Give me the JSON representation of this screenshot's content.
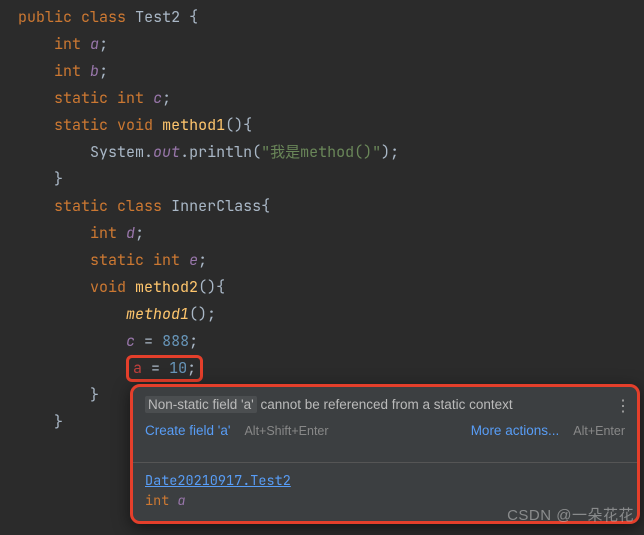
{
  "code": {
    "kw_public": "public",
    "kw_class": "class",
    "kw_int": "int",
    "kw_static": "static",
    "kw_void": "void",
    "cls_Test2": "Test2",
    "cls_InnerClass": "InnerClass",
    "field_a": "a",
    "field_b": "b",
    "field_c": "c",
    "field_d": "d",
    "field_e": "e",
    "method1": "method1",
    "method2": "method2",
    "sys": "System",
    "out": "out",
    "println": "println",
    "str_method": "\"我是method()\"",
    "num_888": "888",
    "num_10": "10",
    "err_a": "a"
  },
  "tooltip": {
    "hl_text": "Non-static field 'a'",
    "msg_rest": " cannot be referenced from a static context",
    "create_field": "Create field 'a'",
    "create_sc": "Alt+Shift+Enter",
    "more_actions": "More actions...",
    "more_sc": "Alt+Enter",
    "ref_cls": "Date20210917.Test2",
    "ref_type": "int ",
    "ref_name": "a"
  },
  "watermark": "CSDN @一朵花花"
}
